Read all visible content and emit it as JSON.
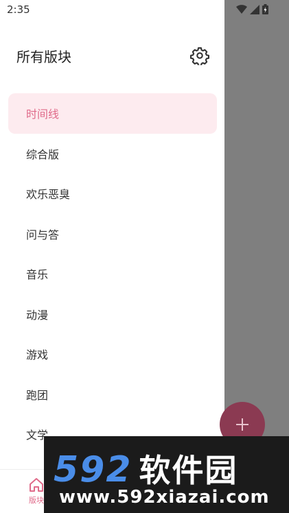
{
  "status_bar": {
    "time": "2:35",
    "icons": [
      "wifi-icon",
      "signal-icon",
      "battery-icon"
    ]
  },
  "drawer": {
    "title": "所有版块",
    "settings_icon": "gear-icon",
    "items": [
      {
        "label": "时间线",
        "selected": true
      },
      {
        "label": "综合版",
        "selected": false
      },
      {
        "label": "欢乐恶臭",
        "selected": false
      },
      {
        "label": "问与答",
        "selected": false
      },
      {
        "label": "音乐",
        "selected": false
      },
      {
        "label": "动漫",
        "selected": false
      },
      {
        "label": "游戏",
        "selected": false
      },
      {
        "label": "跑团",
        "selected": false
      },
      {
        "label": "文学",
        "selected": false
      }
    ]
  },
  "bottom_nav": {
    "label": "版块",
    "icon": "home-icon"
  },
  "fab": {
    "icon": "plus-icon"
  },
  "watermark": {
    "logo_number": "592",
    "logo_text": "软件园",
    "url": "www.592xiazai.com"
  },
  "colors": {
    "accent": "#e06b8a",
    "selected_bg": "#fdebef",
    "scrim": "#7f7f7f",
    "fab": "#8b3a52"
  }
}
